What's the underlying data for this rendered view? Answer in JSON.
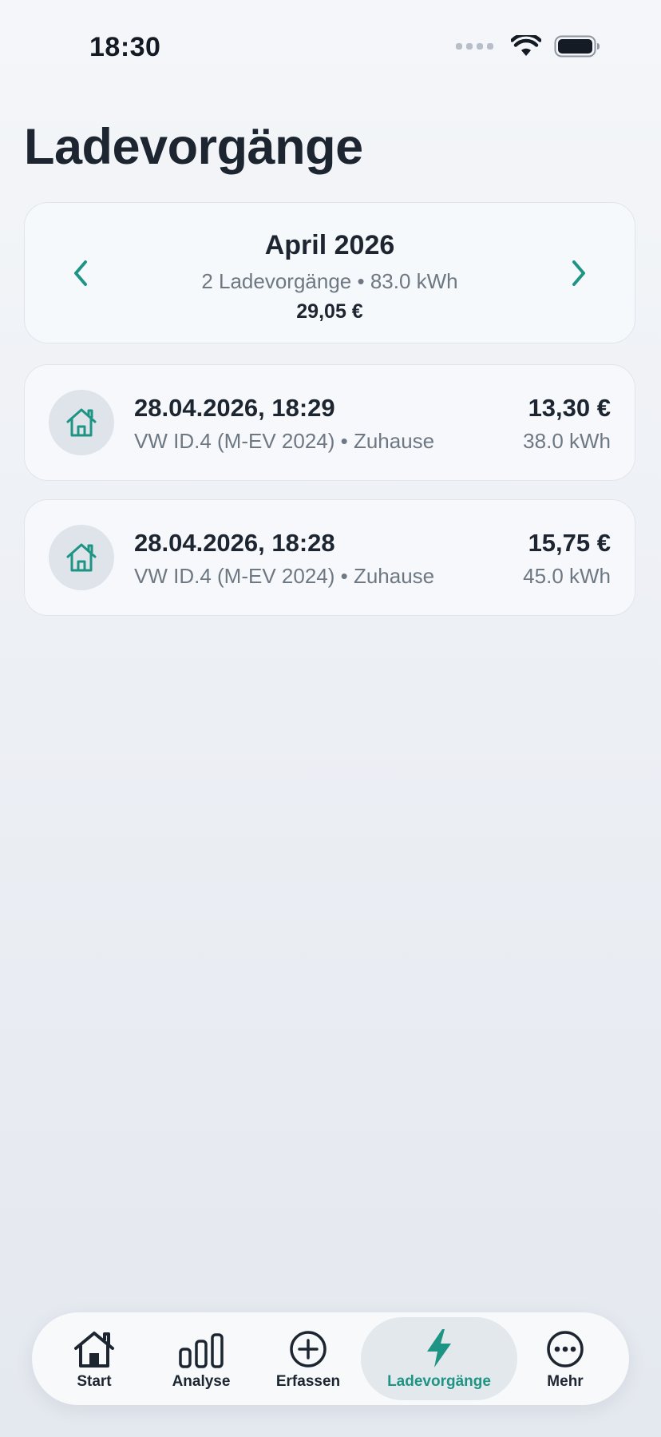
{
  "status": {
    "time": "18:30"
  },
  "page": {
    "title": "Ladevorgänge"
  },
  "month": {
    "title": "April 2026",
    "summary": "2 Ladevorgänge • 83.0 kWh",
    "total": "29,05 €"
  },
  "sessions": [
    {
      "date": "28.04.2026, 18:29",
      "subtitle": "VW ID.4 (M-EV 2024) • Zuhause",
      "price": "13,30 €",
      "kwh": "38.0 kWh",
      "icon": "home-icon"
    },
    {
      "date": "28.04.2026, 18:28",
      "subtitle": "VW ID.4 (M-EV 2024) • Zuhause",
      "price": "15,75 €",
      "kwh": "45.0 kWh",
      "icon": "home-icon"
    }
  ],
  "tabs": [
    {
      "label": "Start",
      "icon": "home-icon"
    },
    {
      "label": "Analyse",
      "icon": "bar-chart-icon"
    },
    {
      "label": "Erfassen",
      "icon": "plus-circle-icon"
    },
    {
      "label": "Ladevorgänge",
      "icon": "lightning-icon",
      "active": true
    },
    {
      "label": "Mehr",
      "icon": "more-icon"
    }
  ],
  "colors": {
    "accent": "#1e9485",
    "text": "#1c2530",
    "muted": "#6e7883"
  }
}
